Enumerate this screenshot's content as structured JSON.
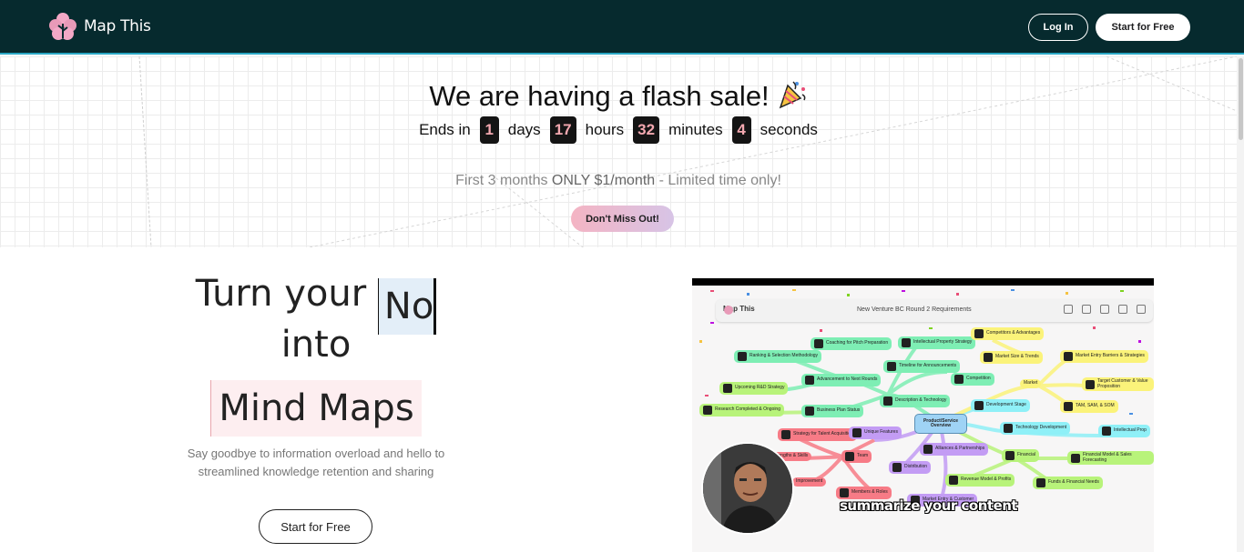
{
  "nav": {
    "brand": "Map This",
    "login_label": "Log In",
    "start_label": "Start for Free"
  },
  "banner": {
    "title": "We are having a flash sale!",
    "ends_in": "Ends in",
    "days_value": "1",
    "days_label": "days",
    "hours_value": "17",
    "hours_label": "hours",
    "minutes_value": "32",
    "minutes_label": "minutes",
    "seconds_value": "4",
    "seconds_label": "seconds",
    "promo_prefix": "First 3 months ",
    "promo_bold": "ONLY $1/month",
    "promo_suffix": " - Limited time only!",
    "cta_label": "Don't Miss Out!"
  },
  "hero": {
    "line1_prefix": "Turn your ",
    "line1_highlight": "No",
    "line2": "into",
    "line3": "Mind Maps",
    "sub_line1": "Say goodbye to information overload and hello to",
    "sub_line2": "streamlined knowledge retention and sharing",
    "cta_label": "Start for Free"
  },
  "video": {
    "app_name": "Map This",
    "doc_title": "New Venture BC Round 2 Requirements",
    "caption": "summarize your content",
    "center_node": "Product/Service Overview",
    "nodes": [
      "Coaching for Pitch Preparation",
      "Intellectual Property Strategy",
      "Competitors & Advantages",
      "Ranking & Selection Methodology",
      "Timeline for Announcements",
      "Market Size & Trends",
      "Market Entry Barriers & Strategies",
      "Advancement to Next Rounds",
      "Competition",
      "Market",
      "Target Customer & Value Proposition",
      "Upcoming R&D Strategy",
      "Description & Technology",
      "Development Stage",
      "TAM, SAM, & SOM",
      "Research Completed & Ongoing",
      "Business Plan Status",
      "Technology Development",
      "Intellectual Prop",
      "Strategy for Talent Acquisition",
      "Unique Features",
      "Alliances & Partnerships",
      "Strengths & Skills",
      "Team",
      "Financial",
      "Financial Model & Sales Forecasting",
      "Distribution",
      "Improvement",
      "Revenue Model & Profits",
      "Funds & Financial Needs",
      "Members & Roles",
      "Market Entry & Customer"
    ]
  },
  "colors": {
    "nav_bg": "#062a2e",
    "nav_accent": "#2aa7c4",
    "countdown_digit": "#f3a8b0",
    "green_node": "#7eeeb4",
    "yellow_node": "#fbf37a",
    "cyan_node": "#8ff0f7",
    "red_node": "#f77b86",
    "purple_node": "#c39cf4",
    "lime_node": "#b8f37a"
  }
}
